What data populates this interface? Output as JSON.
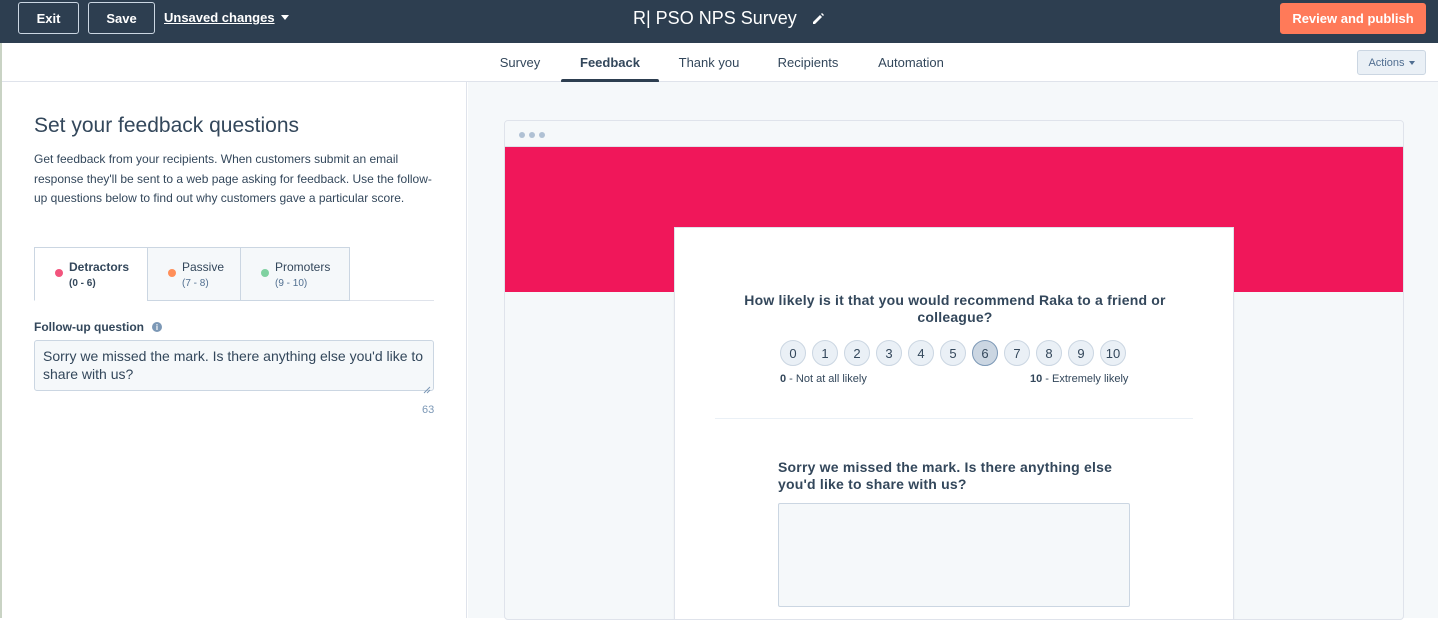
{
  "topbar": {
    "exit_label": "Exit",
    "save_label": "Save",
    "unsaved_label": "Unsaved changes",
    "title": "R| PSO NPS Survey",
    "publish_label": "Review and publish",
    "publish_color": "#ff7a59"
  },
  "nav": {
    "tabs": [
      {
        "label": "Survey"
      },
      {
        "label": "Feedback"
      },
      {
        "label": "Thank you"
      },
      {
        "label": "Recipients"
      },
      {
        "label": "Automation"
      }
    ],
    "active_tab": "Feedback",
    "actions_label": "Actions"
  },
  "left": {
    "title": "Set your feedback questions",
    "description": "Get feedback from your recipients. When customers submit an email response they'll be sent to a web page asking for feedback. Use the follow-up questions below to find out why customers gave a particular score.",
    "segments": [
      {
        "name": "Detractors",
        "range": "(0 - 6)",
        "color": "#f2547d"
      },
      {
        "name": "Passive",
        "range": "(7 - 8)",
        "color": "#ff8f59"
      },
      {
        "name": "Promoters",
        "range": "(9 - 10)",
        "color": "#7fd1a0"
      }
    ],
    "active_segment": "Detractors",
    "followup_label": "Follow-up question",
    "followup_value": "Sorry we missed the mark. Is there anything else you'd like to share with us?",
    "char_count": "63"
  },
  "preview": {
    "hero_color": "#f0175a",
    "question": "How likely is it that you would recommend Raka to a friend or colleague?",
    "scale": [
      "0",
      "1",
      "2",
      "3",
      "4",
      "5",
      "6",
      "7",
      "8",
      "9",
      "10"
    ],
    "selected_score": "6",
    "low_num": "0",
    "low_text": " - Not at all likely",
    "high_num": "10",
    "high_text": " - Extremely likely",
    "followup_question": "Sorry we missed the mark. Is there anything else you'd like to share with us?"
  }
}
